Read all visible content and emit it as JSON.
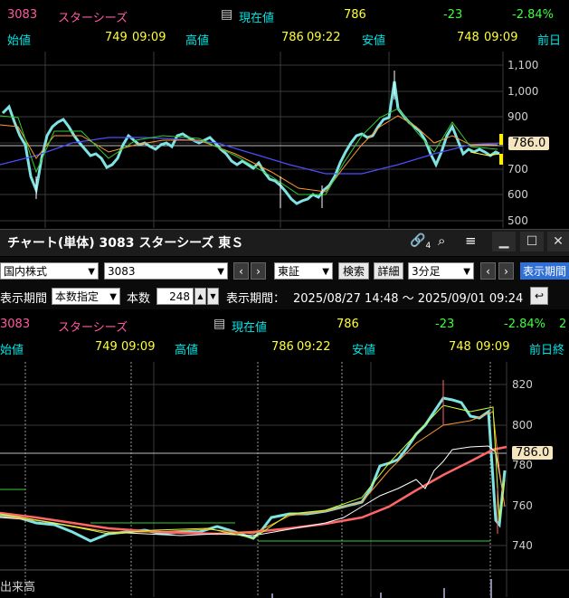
{
  "top_header": {
    "code": "3083",
    "name": "スターシーズ",
    "current_label": "現在値",
    "current": "786",
    "change": "-23",
    "change_pct": "-2.84%"
  },
  "top_ohlc": {
    "open_label": "始値",
    "open": "749",
    "open_time": "09:09",
    "high_label": "高値",
    "high": "786",
    "high_time": "09:22",
    "low_label": "安値",
    "low": "748",
    "low_time": "09:09",
    "prev_label": "前日"
  },
  "top_axis": [
    "1,100",
    "1,000",
    "900",
    "800",
    "700",
    "600",
    "500"
  ],
  "top_price_tag": "786.0",
  "window": {
    "title": "チャート(単体) 3083 スターシーズ 東Ｓ",
    "link_count": "4"
  },
  "toolbar": {
    "market": "国内株式",
    "code": "3083",
    "exchange": "東証",
    "search": "検索",
    "detail": "詳細",
    "interval": "3分足",
    "display_button": "表示期間"
  },
  "toolbar2": {
    "period_label": "表示期間",
    "period_mode": "本数指定",
    "count_label": "本数",
    "count": "248",
    "range_label": "表示期間：",
    "range": "2025/08/27 14:48 〜 2025/09/01 09:24"
  },
  "bottom_header": {
    "code": "3083",
    "name": "スターシーズ",
    "current_label": "現在値",
    "current": "786",
    "change": "-23",
    "change_pct": "-2.84%",
    "extra": "2"
  },
  "bottom_ohlc": {
    "open_label": "始値",
    "open": "749",
    "open_time": "09:09",
    "high_label": "高値",
    "high": "786",
    "high_time": "09:22",
    "low_label": "安値",
    "low": "748",
    "low_time": "09:09",
    "prev_label": "前日終"
  },
  "bottom_axis": [
    "820",
    "800",
    "780",
    "760",
    "740"
  ],
  "bottom_price_tag": "786.0",
  "volume_label": "出来高"
}
